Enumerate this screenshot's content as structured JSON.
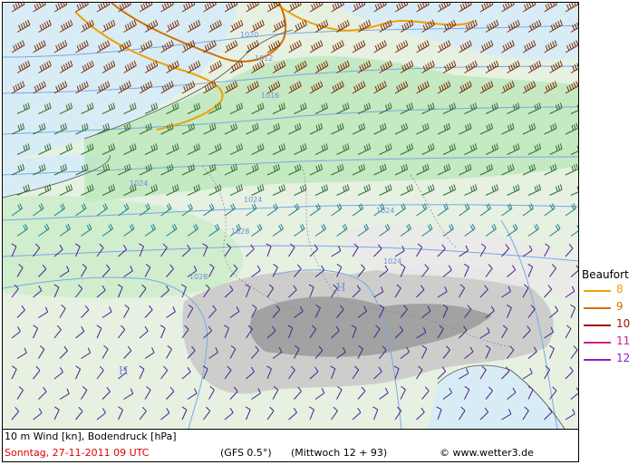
{
  "map": {
    "pressure_labels": [
      "1020",
      "1012",
      "1016",
      "1024",
      "1024",
      "1028",
      "1024",
      "1024",
      "1028"
    ],
    "highs": [
      "H",
      "H"
    ],
    "wind_colors": {
      "north": "#7a2800",
      "mid": "#2e6e2e",
      "teal": "#1f7f8a",
      "south": "#4b1f8a"
    }
  },
  "legend": {
    "title": "Beaufort",
    "items": [
      {
        "label": "8",
        "color": "#f0a000"
      },
      {
        "label": "9",
        "color": "#d07000"
      },
      {
        "label": "10",
        "color": "#a01010"
      },
      {
        "label": "11",
        "color": "#d02090"
      },
      {
        "label": "12",
        "color": "#9020c0"
      }
    ]
  },
  "footer": {
    "line1": "10 m Wind [kn], Bodendruck [hPa]",
    "date": "Sonntag, 27-11-2011  09 UTC",
    "model": "(GFS 0.5°)",
    "run": "(Mittwoch 12 + 93)",
    "copyright": "© www.wetter3.de"
  }
}
